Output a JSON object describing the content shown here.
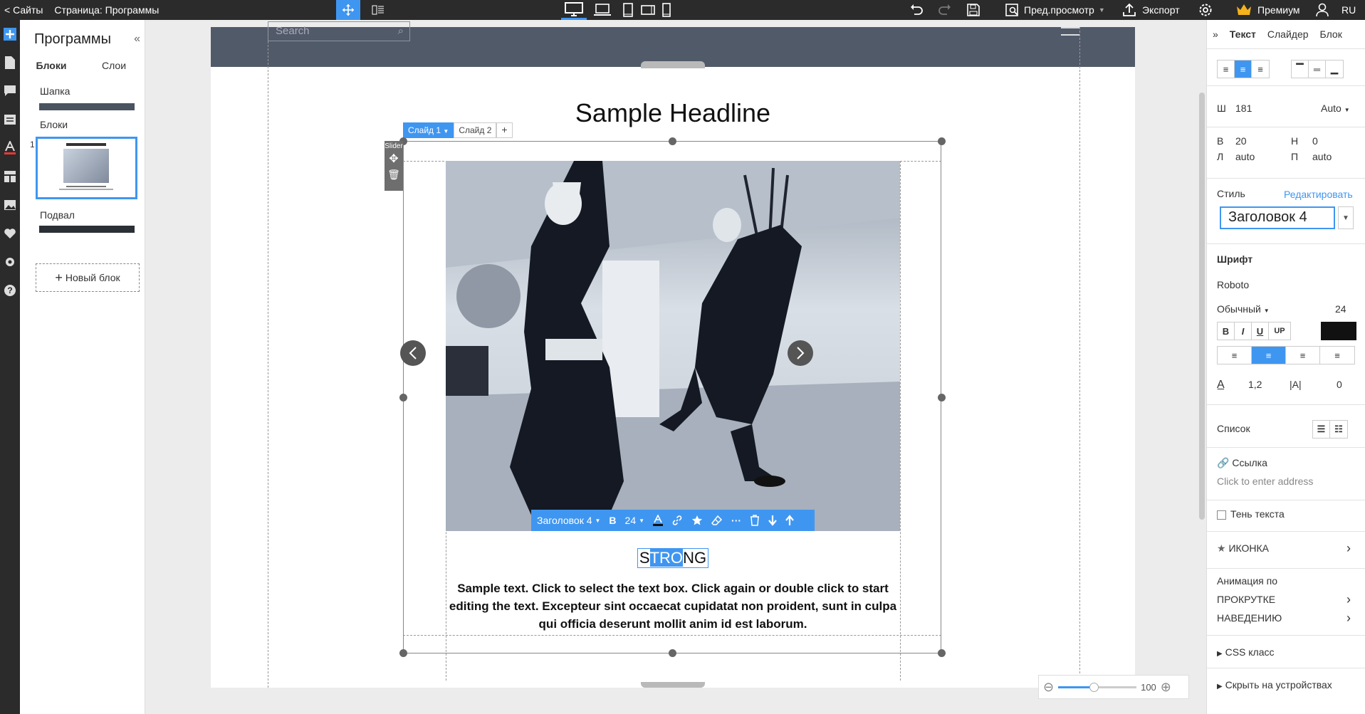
{
  "topbar": {
    "back_label": "< Сайты",
    "page_label": "Страница: Программы",
    "preview_label": "Пред.просмотр",
    "export_label": "Экспорт",
    "premium_label": "Премиум",
    "lang_label": "RU"
  },
  "leftpanel": {
    "title": "Программы",
    "tabs": [
      "Блоки",
      "Слои"
    ],
    "header_label": "Шапка",
    "blocks_label": "Блоки",
    "block_number": "1",
    "footer_label": "Подвал",
    "new_block_label": "Новый блок"
  },
  "page": {
    "search_placeholder": "Search",
    "headline": "Sample Headline",
    "slide_tabs": [
      "Слайд 1",
      "Слайд 2"
    ],
    "slider_tag": "Slider",
    "strong_pre": "S",
    "strong_sel": "TRO",
    "strong_post": "NG",
    "paragraph": "Sample text. Click to select the text box. Click again or double click to start editing the text. Excepteur sint occaecat cupidatat non proident, sunt in culpa qui officia deserunt mollit anim id est laborum."
  },
  "text_toolbar": {
    "style": "Заголовок 4",
    "bold": "B",
    "size": "24"
  },
  "zoom": {
    "value": "100"
  },
  "rightpanel": {
    "tabs": [
      "Текст",
      "Слайдер",
      "Блок"
    ],
    "width_label": "Ш",
    "width_value": "181",
    "width_mode": "Auto",
    "top_label": "В",
    "top_value": "20",
    "bottom_label": "Н",
    "bottom_value": "0",
    "left_label": "Л",
    "left_value": "auto",
    "right_label": "П",
    "right_value": "auto",
    "style_label": "Стиль",
    "edit_label": "Редактировать",
    "style_value": "Заголовок 4",
    "font_label": "Шрифт",
    "font_value": "Roboto",
    "weight_value": "Обычный",
    "size_value": "24",
    "format_buttons": [
      "B",
      "I",
      "U",
      "UP"
    ],
    "line_height": "1,2",
    "letter_spacing": "0",
    "list_label": "Список",
    "link_label": "Ссылка",
    "link_placeholder": "Click to enter address",
    "shadow_label": "Тень текста",
    "icon_label": "ИКОНКА",
    "animation_label": "Анимация по",
    "scroll_label": "ПРОКРУТКЕ",
    "hover_label": "НАВЕДЕНИЮ",
    "css_label": "CSS класс",
    "hide_label": "Скрыть на устройствах"
  },
  "colors": {
    "accent": "#3f96f0",
    "header": "#515a69",
    "chrome": "#2b2b2b"
  }
}
